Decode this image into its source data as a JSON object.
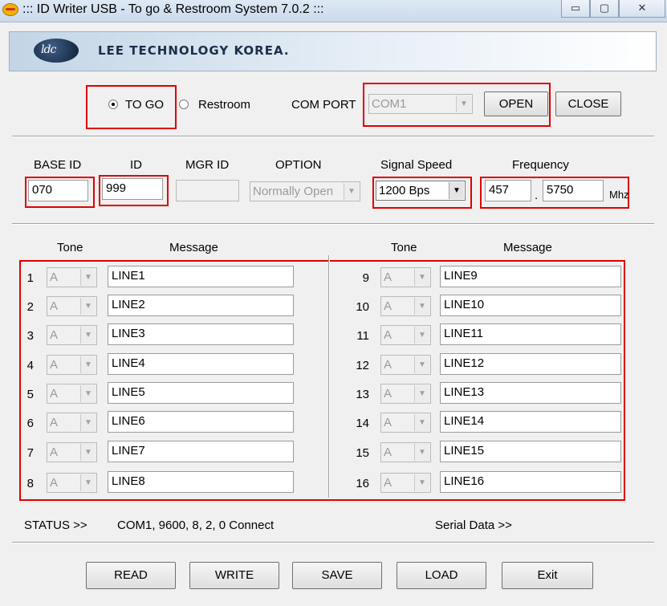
{
  "window": {
    "title": "::: ID Writer USB - To go & Restroom System 7.0.2  :::",
    "minimize": "▭",
    "maximize": "▢",
    "close": "✕"
  },
  "banner": {
    "logo_text": "ldc",
    "company": "LEE TECHNOLOGY KOREA."
  },
  "mode": {
    "togo_label": "TO GO",
    "restroom_label": "Restroom",
    "selected": "TO GO"
  },
  "port": {
    "label": "COM PORT",
    "value": "COM1",
    "open_label": "OPEN",
    "close_label": "CLOSE"
  },
  "settings": {
    "base_id_label": "BASE ID",
    "base_id_value": "070",
    "id_label": "ID",
    "id_value": "999",
    "mgr_id_label": "MGR ID",
    "mgr_id_value": "",
    "option_label": "OPTION",
    "option_value": "Normally Open",
    "signal_speed_label": "Signal Speed",
    "signal_speed_value": "1200 Bps",
    "frequency_label": "Frequency",
    "freq_major": "457",
    "freq_sep": ".",
    "freq_minor": "5750",
    "freq_unit": "Mhz"
  },
  "messages": {
    "tone_header": "Tone",
    "message_header": "Message",
    "lines": [
      {
        "num": "1",
        "tone": "A",
        "text": "LINE1"
      },
      {
        "num": "2",
        "tone": "A",
        "text": "LINE2"
      },
      {
        "num": "3",
        "tone": "A",
        "text": "LINE3"
      },
      {
        "num": "4",
        "tone": "A",
        "text": "LINE4"
      },
      {
        "num": "5",
        "tone": "A",
        "text": "LINE5"
      },
      {
        "num": "6",
        "tone": "A",
        "text": "LINE6"
      },
      {
        "num": "7",
        "tone": "A",
        "text": "LINE7"
      },
      {
        "num": "8",
        "tone": "A",
        "text": "LINE8"
      },
      {
        "num": "9",
        "tone": "A",
        "text": "LINE9"
      },
      {
        "num": "10",
        "tone": "A",
        "text": "LINE10"
      },
      {
        "num": "11",
        "tone": "A",
        "text": "LINE11"
      },
      {
        "num": "12",
        "tone": "A",
        "text": "LINE12"
      },
      {
        "num": "13",
        "tone": "A",
        "text": "LINE13"
      },
      {
        "num": "14",
        "tone": "A",
        "text": "LINE14"
      },
      {
        "num": "15",
        "tone": "A",
        "text": "LINE15"
      },
      {
        "num": "16",
        "tone": "A",
        "text": "LINE16"
      }
    ]
  },
  "status": {
    "label": "STATUS  >>",
    "value": "COM1, 9600, 8, 2, 0 Connect",
    "serial_label": "Serial Data  >>"
  },
  "buttons": {
    "read": "READ",
    "write": "WRITE",
    "save": "SAVE",
    "load": "LOAD",
    "exit": "Exit"
  },
  "colors": {
    "highlight_box": "#e00000",
    "background": "#f0f0f0"
  }
}
